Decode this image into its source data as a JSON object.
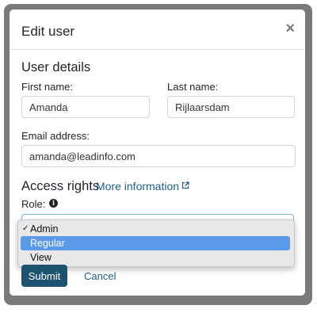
{
  "modal": {
    "title": "Edit user",
    "close_glyph": "×"
  },
  "user_details": {
    "heading": "User details",
    "first_name_label": "First name:",
    "first_name_value": "Amanda",
    "last_name_label": "Last name:",
    "last_name_value": "Rijlaarsdam",
    "email_label": "Email address:",
    "email_value": "amanda@leadinfo.com"
  },
  "access_rights": {
    "heading": "Access rights",
    "more_info_link": "More information",
    "role_label": "Role:",
    "role_options": [
      "Admin",
      "Regular",
      "View"
    ],
    "checked_option": "Admin",
    "highlighted_option": "Regular"
  },
  "actions": {
    "submit_label": "Submit",
    "cancel_label": "Cancel"
  },
  "colors": {
    "primary": "#1d5270",
    "link": "#1f5f8b",
    "highlight": "#5b9ae8"
  },
  "icons": [
    "close-icon",
    "external-link-icon",
    "info-icon",
    "checkmark-icon",
    "select-caret-icon"
  ]
}
